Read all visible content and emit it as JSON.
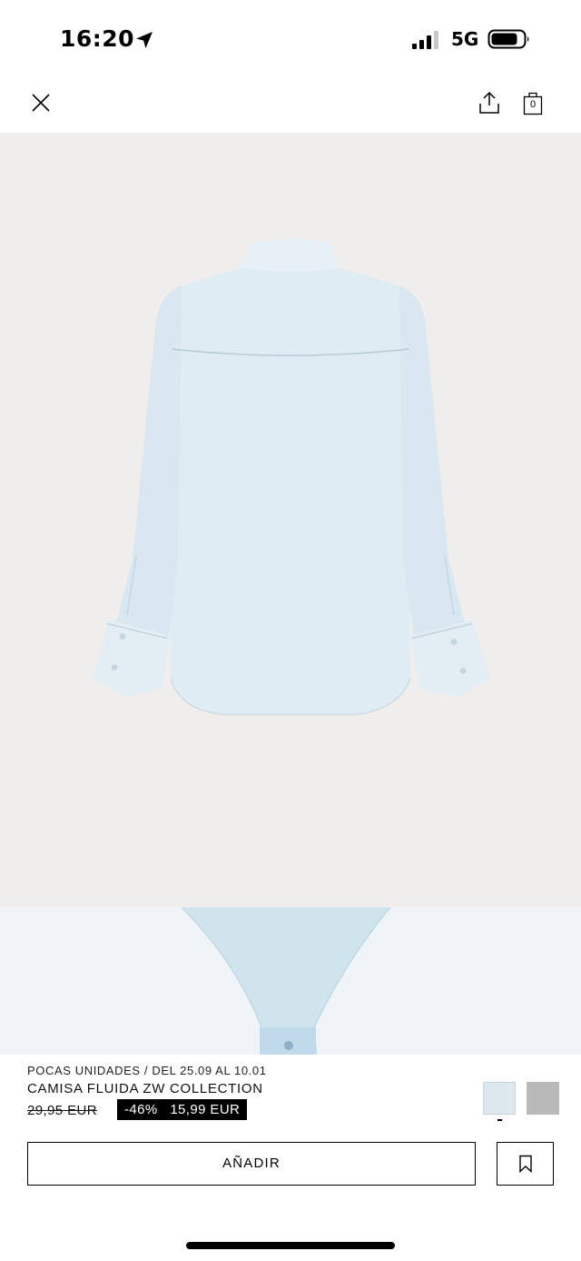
{
  "status_bar": {
    "time": "16:20",
    "network": "5G"
  },
  "nav": {
    "bag_count": "0"
  },
  "product": {
    "availability": "POCAS UNIDADES / DEL 25.09 AL 10.01",
    "name": "CAMISA FLUIDA ZW COLLECTION",
    "old_price": "29,95 EUR",
    "discount_label": "-46%   15,99 EUR",
    "swatches": [
      {
        "color": "#dde8ee",
        "selected": true
      },
      {
        "color": "#b9b9b9",
        "selected": false
      }
    ]
  },
  "actions": {
    "add_label": "AÑADIR"
  },
  "icons": {
    "close": "close-icon",
    "share": "share-icon",
    "bag": "shopping-bag-icon",
    "bookmark": "bookmark-icon",
    "location": "location-arrow-icon",
    "signal": "signal-icon",
    "battery": "battery-icon"
  },
  "colors": {
    "hero_background": "#efeeec",
    "shirt": "#dfecf3",
    "tag_background": "#000000"
  }
}
